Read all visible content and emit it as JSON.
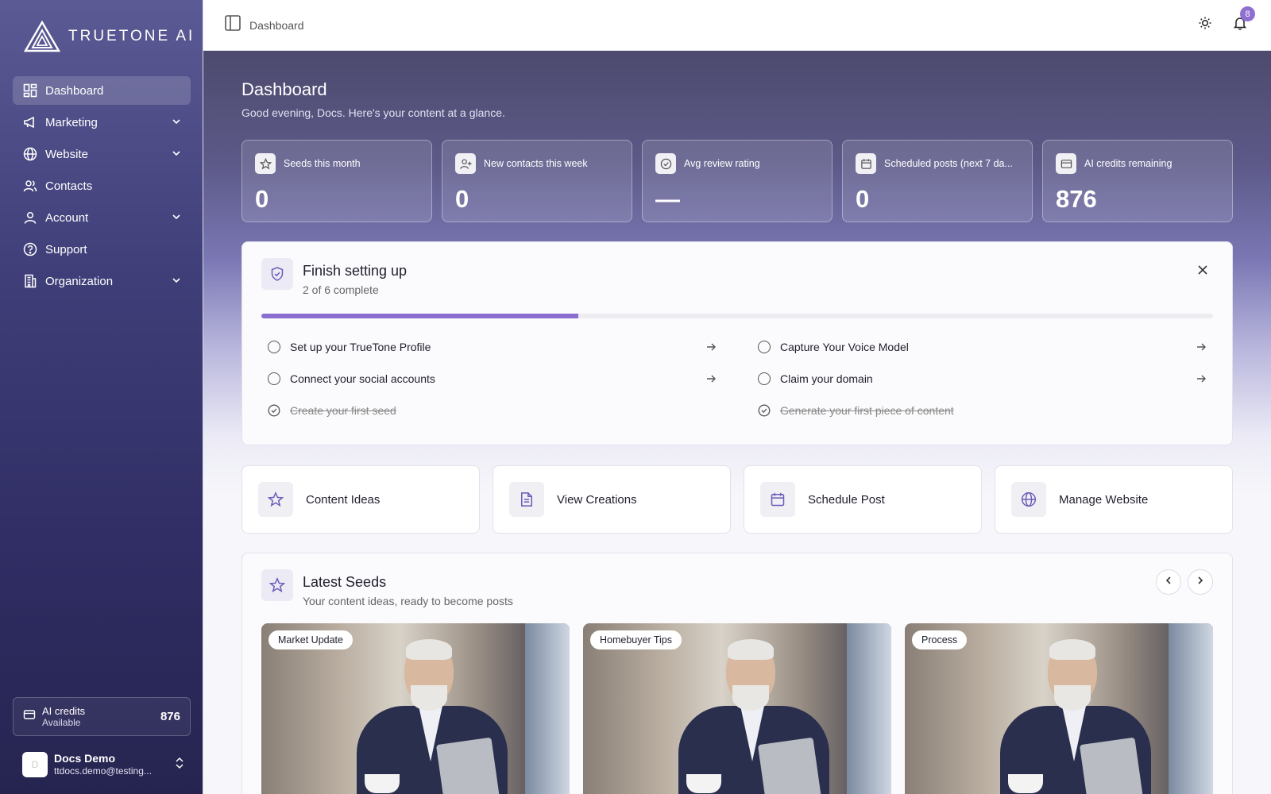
{
  "brand": {
    "name": "TRUETONE AI"
  },
  "sidebar": {
    "items": [
      {
        "label": "Dashboard",
        "icon": "dashboard-icon",
        "active": true,
        "expandable": false
      },
      {
        "label": "Marketing",
        "icon": "megaphone-icon",
        "active": false,
        "expandable": true
      },
      {
        "label": "Website",
        "icon": "globe-icon",
        "active": false,
        "expandable": true
      },
      {
        "label": "Contacts",
        "icon": "users-icon",
        "active": false,
        "expandable": false
      },
      {
        "label": "Account",
        "icon": "user-icon",
        "active": false,
        "expandable": true
      },
      {
        "label": "Support",
        "icon": "help-circle-icon",
        "active": false,
        "expandable": false
      },
      {
        "label": "Organization",
        "icon": "building-icon",
        "active": false,
        "expandable": true
      }
    ],
    "credits": {
      "label": "AI credits",
      "sublabel": "Available",
      "value": "876"
    },
    "user": {
      "avatar_initial": "D",
      "name": "Docs Demo",
      "email": "ttdocs.demo@testing..."
    }
  },
  "topbar": {
    "breadcrumb": "Dashboard",
    "notification_count": "8"
  },
  "header": {
    "title": "Dashboard",
    "subtitle": "Good evening, Docs. Here's your content at a glance."
  },
  "stats": [
    {
      "label": "Seeds this month",
      "value": "0",
      "icon": "star-icon"
    },
    {
      "label": "New contacts this week",
      "value": "0",
      "icon": "user-plus-icon"
    },
    {
      "label": "Avg review rating",
      "value": "—",
      "icon": "check-circle-icon"
    },
    {
      "label": "Scheduled posts (next 7 da...",
      "value": "0",
      "icon": "calendar-icon"
    },
    {
      "label": "AI credits remaining",
      "value": "876",
      "icon": "credit-card-icon"
    }
  ],
  "setup": {
    "title": "Finish setting up",
    "subtitle": "2 of 6 complete",
    "progress": 0.333,
    "tasks": [
      {
        "label": "Set up your TrueTone Profile",
        "done": false
      },
      {
        "label": "Capture Your Voice Model",
        "done": false
      },
      {
        "label": "Connect your social accounts",
        "done": false
      },
      {
        "label": "Claim your domain",
        "done": false
      },
      {
        "label": "Create your first seed",
        "done": true
      },
      {
        "label": "Generate your first piece of content",
        "done": true
      }
    ]
  },
  "actions": [
    {
      "label": "Content Ideas",
      "icon": "star-icon"
    },
    {
      "label": "View Creations",
      "icon": "document-icon"
    },
    {
      "label": "Schedule Post",
      "icon": "calendar-icon"
    },
    {
      "label": "Manage Website",
      "icon": "globe-icon"
    }
  ],
  "seeds": {
    "title": "Latest Seeds",
    "subtitle": "Your content ideas, ready to become posts",
    "cards": [
      {
        "tag": "Market Update"
      },
      {
        "tag": "Homebuyer Tips"
      },
      {
        "tag": "Process"
      }
    ]
  },
  "colors": {
    "accent": "#8b6fd0",
    "sidebar": "#3f3e78"
  }
}
